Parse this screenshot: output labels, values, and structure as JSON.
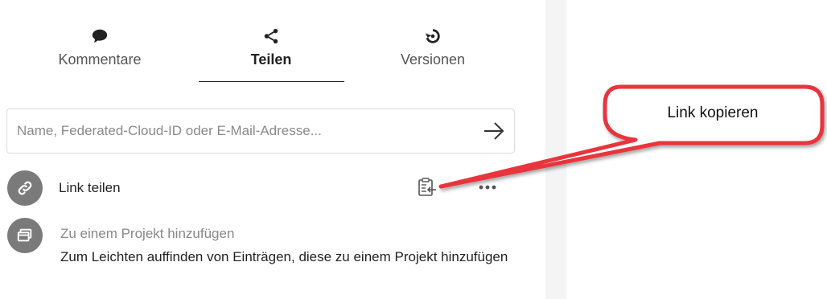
{
  "tabs": [
    {
      "label": "Kommentare",
      "icon": "comment-icon"
    },
    {
      "label": "Teilen",
      "icon": "share-icon",
      "active": true
    },
    {
      "label": "Versionen",
      "icon": "history-icon"
    }
  ],
  "search": {
    "placeholder": "Name, Federated-Cloud-ID oder E-Mail-Adresse...",
    "value": ""
  },
  "share_link": {
    "label": "Link teilen",
    "icon": "link-icon",
    "copy_icon": "clipboard-icon",
    "more_icon": "more-dots-icon"
  },
  "project": {
    "title": "Zu einem Projekt hinzufügen",
    "description": "Zum Leichten auffinden von Einträgen, diese zu einem Projekt hinzufügen",
    "icon": "project-icon"
  },
  "callout": {
    "text": "Link kopieren",
    "border_color": "#e8343c"
  }
}
